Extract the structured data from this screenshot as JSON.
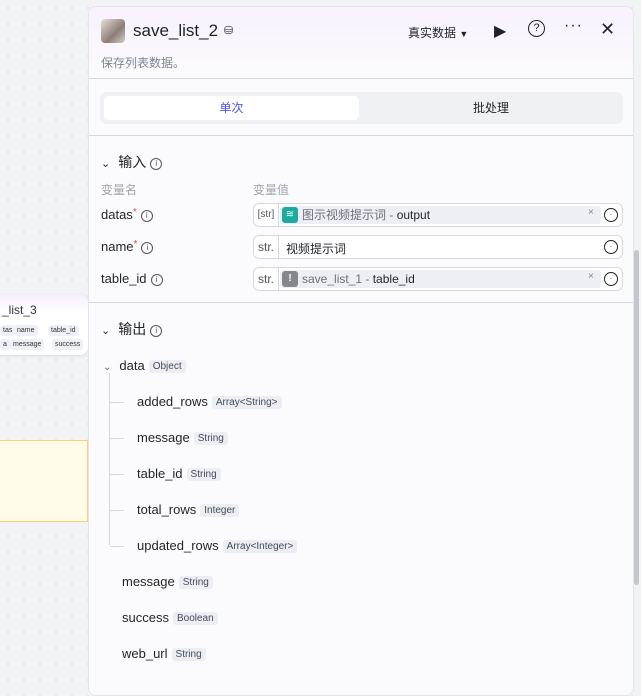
{
  "canvas": {
    "node_title": "_list_3",
    "node_inputs": [
      "tas",
      "name",
      "table_id"
    ],
    "node_outputs": [
      "a",
      "message",
      "success"
    ]
  },
  "header": {
    "title": "save_list_2",
    "description": "保存列表数据。",
    "data_mode": "真实数据"
  },
  "tabs": [
    {
      "label": "单次",
      "active": true
    },
    {
      "label": "批处理",
      "active": false
    }
  ],
  "input": {
    "title": "输入",
    "col_name": "变量名",
    "col_value": "变量值",
    "rows": [
      {
        "name": "datas",
        "required": true,
        "type": "[str]",
        "ref_node": "图示视频提示词",
        "ref_field": "output",
        "ref_color": "#1aad9f"
      },
      {
        "name": "name",
        "required": true,
        "type": "str.",
        "value": "视频提示词"
      },
      {
        "name": "table_id",
        "required": false,
        "type": "str.",
        "ref_node": "save_list_1",
        "ref_field": "table_id",
        "ref_color": "#85878d"
      }
    ]
  },
  "output": {
    "title": "输出",
    "data": {
      "name": "data",
      "type": "Object",
      "children": [
        {
          "name": "added_rows",
          "type": "Array<String>"
        },
        {
          "name": "message",
          "type": "String"
        },
        {
          "name": "table_id",
          "type": "String"
        },
        {
          "name": "total_rows",
          "type": "Integer"
        },
        {
          "name": "updated_rows",
          "type": "Array<Integer>"
        }
      ]
    },
    "fields": [
      {
        "name": "message",
        "type": "String"
      },
      {
        "name": "success",
        "type": "Boolean"
      },
      {
        "name": "web_url",
        "type": "String"
      }
    ]
  }
}
